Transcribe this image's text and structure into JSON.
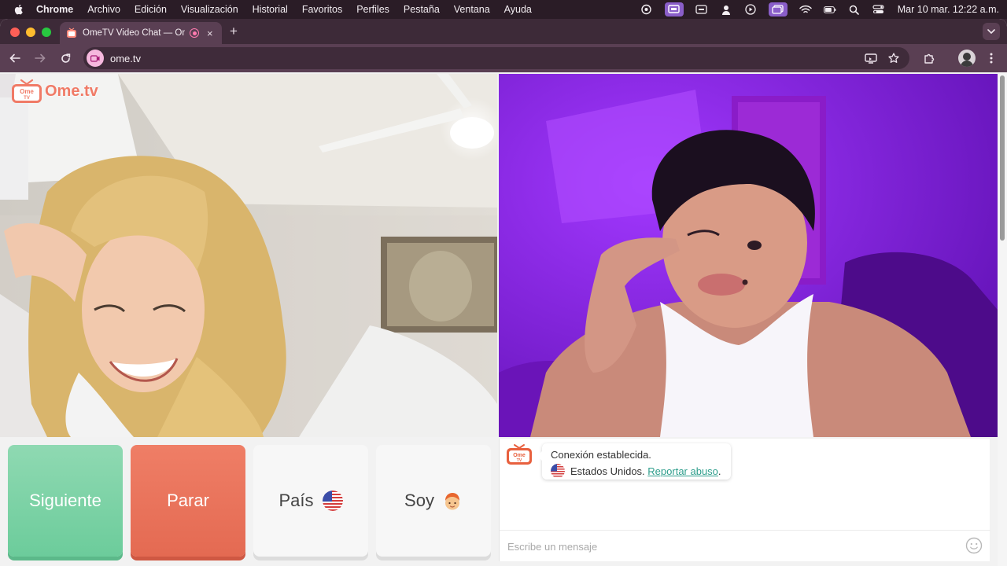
{
  "menubar": {
    "app_name": "Chrome",
    "items": [
      "Archivo",
      "Edición",
      "Visualización",
      "Historial",
      "Favoritos",
      "Perfiles",
      "Pestaña",
      "Ventana",
      "Ayuda"
    ],
    "clock": "Mar 10 mar.  12:22 a.m.",
    "status_icons": [
      "scan-icon",
      "screen-share-icon",
      "caption-icon",
      "person-icon",
      "play-icon",
      "window-icon",
      "wifi-icon",
      "battery-icon",
      "search-icon",
      "control-center-icon"
    ]
  },
  "browser": {
    "tab_title": "OmeTV Video Chat — Omegle",
    "tab_close": "×",
    "new_tab": "+",
    "url": "ome.tv"
  },
  "page": {
    "logo_text": "Ome.tv",
    "logo_badge": "Ome TV",
    "buttons": {
      "next": "Siguiente",
      "stop": "Parar",
      "country": "País",
      "gender": "Soy"
    },
    "chat": {
      "message_line1": "Conexión establecida.",
      "message_country": "Estados Unidos.",
      "report_link": "Reportar abuso",
      "report_suffix": ".",
      "input_placeholder": "Escribe un mensaje"
    }
  },
  "colors": {
    "next_button": "#7fd4a7",
    "stop_button": "#ea735b",
    "remote_video_bg": "#7a17d6",
    "report_link": "#2e9e8c"
  }
}
